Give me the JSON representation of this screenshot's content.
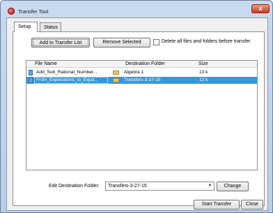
{
  "window": {
    "title": "Transfer Tool",
    "close_glyph": "x"
  },
  "tabs": [
    {
      "label": "Setup"
    },
    {
      "label": "Status"
    }
  ],
  "toolbar": {
    "add_label": "Add to Transfer List",
    "remove_label": "Remove Selected",
    "delete_all_label": "Delete all files and folders before transfer",
    "delete_all_checked": false
  },
  "table": {
    "headers": {
      "file": "File Name",
      "dest": "Destination Folder",
      "size": "Size"
    },
    "rows": [
      {
        "file": "Add_Sub_Rational_Number...",
        "dest": "Algebra 1",
        "size": "13 k",
        "selected": false
      },
      {
        "file": "From_Expressions_to_Equa...",
        "dest": "Transfers-3-27-15",
        "size": "12 k",
        "selected": true
      }
    ]
  },
  "edit": {
    "label": "Edit Destination Folder:",
    "value": "Transfers-3-27-15",
    "change_label": "Change"
  },
  "footer": {
    "start_label": "Start Transfer",
    "close_label": "Close"
  },
  "colors": {
    "selection": "#3399dd",
    "titlebar": "#c9daee"
  },
  "icons": [
    "app-icon",
    "close-icon",
    "file-icon",
    "folder-icon",
    "chevron-down-icon"
  ]
}
